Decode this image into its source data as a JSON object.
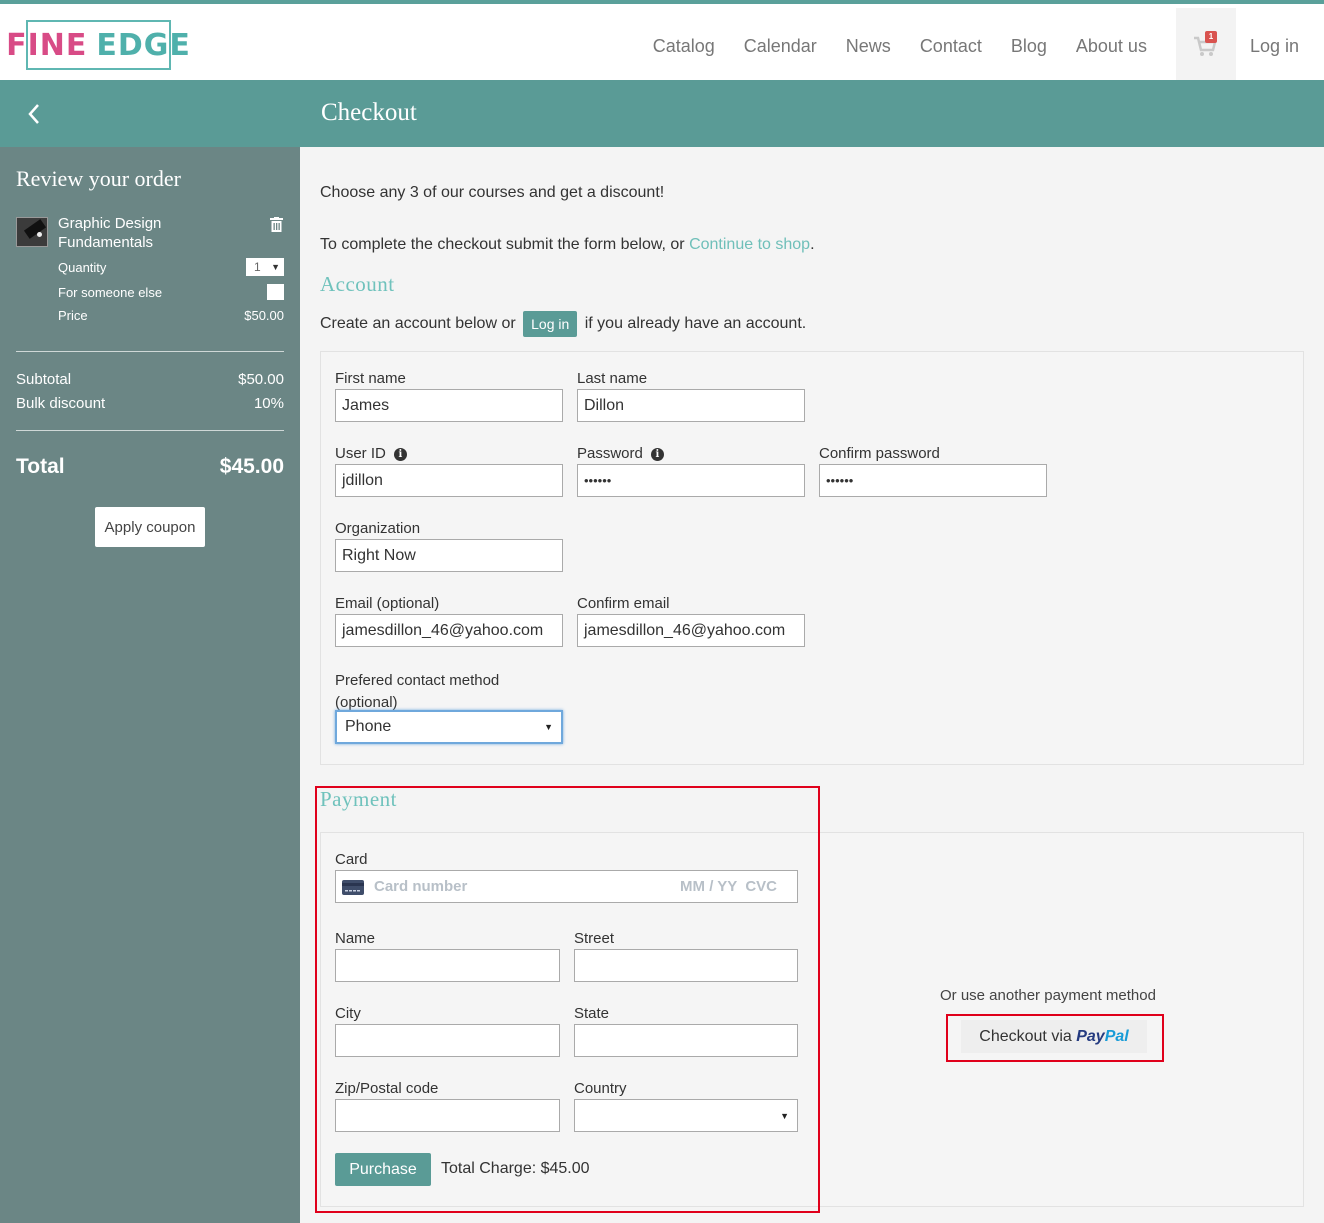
{
  "brand": {
    "word1": "FINE",
    "word2": "EDGE"
  },
  "nav": {
    "items": [
      "Catalog",
      "Calendar",
      "News",
      "Contact",
      "Blog",
      "About us"
    ],
    "cart_count": "1",
    "login": "Log in"
  },
  "header": {
    "title": "Checkout"
  },
  "sidebar": {
    "title": "Review your order",
    "item": {
      "name": "Graphic Design Fundamentals",
      "quantity_label": "Quantity",
      "quantity_value": "1",
      "someone_else_label": "For someone else",
      "price_label": "Price",
      "price_value": "$50.00"
    },
    "subtotal_label": "Subtotal",
    "subtotal_value": "$50.00",
    "discount_label": "Bulk discount",
    "discount_value": "10%",
    "total_label": "Total",
    "total_value": "$45.00",
    "coupon_button": "Apply coupon"
  },
  "main": {
    "promo": "Choose any 3 of our courses and get a discount!",
    "complete_text": "To complete the checkout submit the form below, or ",
    "continue_link": "Continue to shop",
    "complete_end": ".",
    "account_title": "Account",
    "account_pre": "Create an account below or ",
    "account_login": "Log in",
    "account_post": " if you already have an account."
  },
  "account": {
    "first_name": {
      "label": "First name",
      "value": "James"
    },
    "last_name": {
      "label": "Last name",
      "value": "Dillon"
    },
    "user_id": {
      "label": "User ID",
      "value": "jdillon"
    },
    "password": {
      "label": "Password",
      "value": "••••••"
    },
    "confirm_password": {
      "label": "Confirm password",
      "value": "••••••"
    },
    "organization": {
      "label": "Organization",
      "value": "Right Now"
    },
    "email": {
      "label": "Email (optional)",
      "value": "jamesdillon_46@yahoo.com"
    },
    "confirm_email": {
      "label": "Confirm email",
      "value": "jamesdillon_46@yahoo.com"
    },
    "contact_method": {
      "label": "Prefered contact method (optional)",
      "value": "Phone"
    }
  },
  "payment": {
    "title": "Payment",
    "card_label": "Card",
    "card_placeholder": "Card number",
    "card_expiry": "MM / YY  CVC",
    "name_label": "Name",
    "street_label": "Street",
    "city_label": "City",
    "state_label": "State",
    "zip_label": "Zip/Postal code",
    "country_label": "Country",
    "purchase_button": "Purchase",
    "total_charge": "Total Charge: $45.00",
    "alt_text": "Or use another payment method",
    "paypal_prefix": "Checkout via ",
    "paypal_word1": "Pay",
    "paypal_word2": "Pal"
  },
  "colors": {
    "teal": "#5a9b96",
    "sidebar": "#6b8685",
    "accent_text": "#6fc2bc",
    "highlight": "#e0001b"
  }
}
